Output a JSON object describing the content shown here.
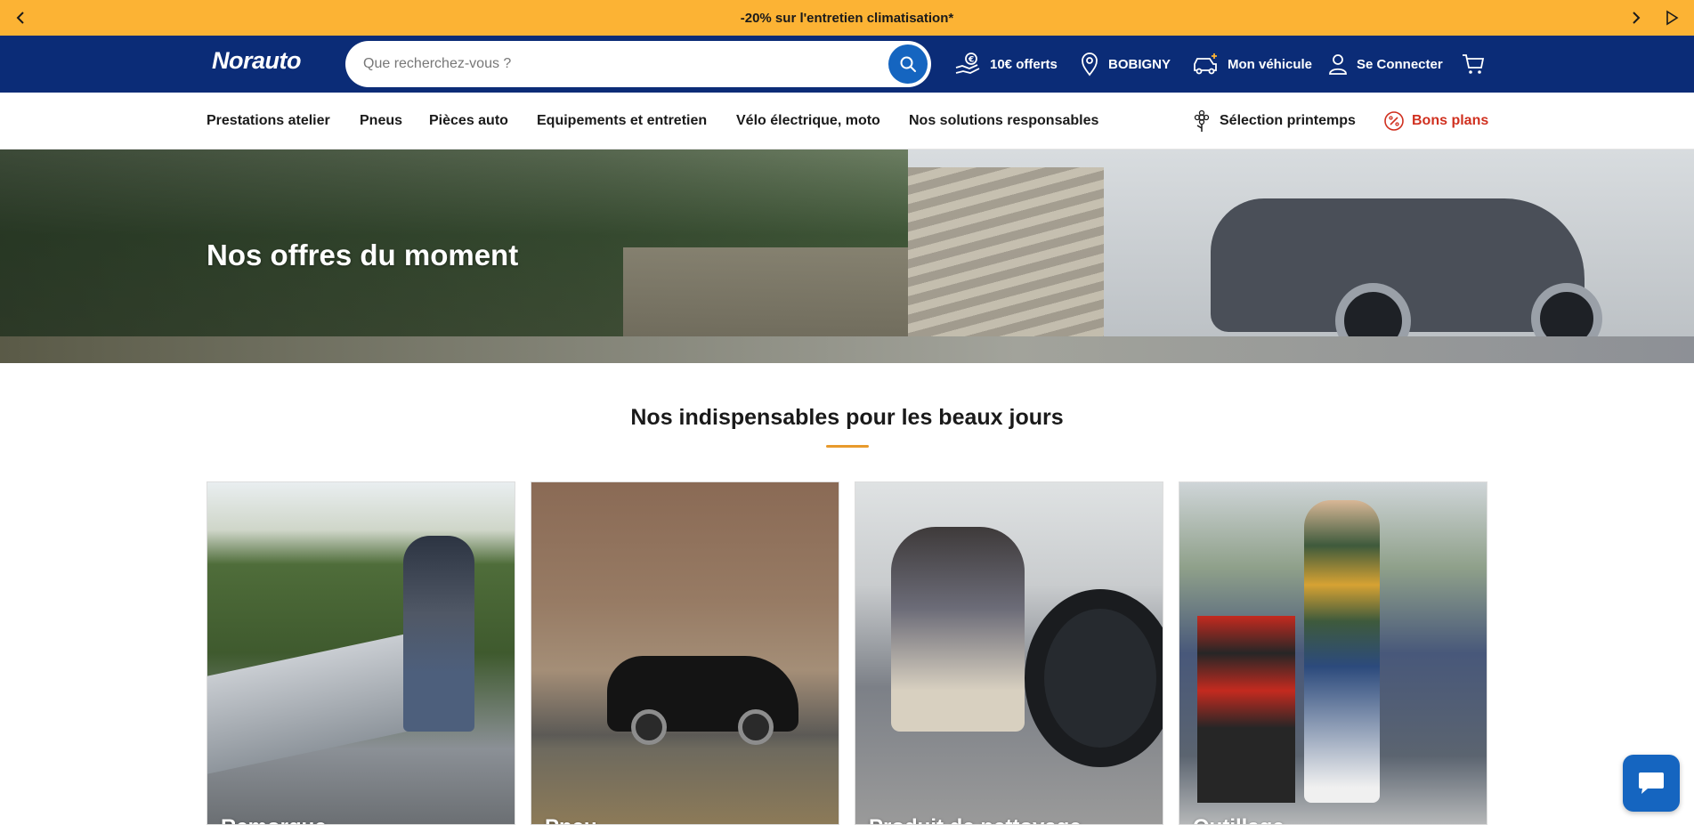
{
  "promo": {
    "text": "-20% sur l'entretien climatisation*"
  },
  "header": {
    "logo": {
      "main": "Norauto"
    },
    "search": {
      "placeholder": "Que recherchez-vous ?"
    },
    "offer_label": "10€ offerts",
    "store_label": "BOBIGNY",
    "vehicle_label": "Mon véhicule",
    "login_label": "Se Connecter"
  },
  "nav": {
    "items": [
      {
        "label": "Prestations atelier"
      },
      {
        "label": "Pneus"
      },
      {
        "label": "Pièces auto"
      },
      {
        "label": "Equipements et entretien"
      },
      {
        "label": "Vélo électrique, moto"
      },
      {
        "label": "Nos solutions responsables"
      }
    ],
    "spring_label": "Sélection printemps",
    "deals_label": "Bons plans"
  },
  "hero": {
    "title": "Nos offres du moment"
  },
  "section": {
    "title": "Nos indispensables pour les beaux jours",
    "cards": [
      {
        "label": "Remorque"
      },
      {
        "label": "Pneu"
      },
      {
        "label": "Produit de nettoyage"
      },
      {
        "label": "Outillage"
      }
    ]
  },
  "colors": {
    "promo_bg": "#fcb334",
    "header_bg": "#0b2c77",
    "search_btn": "#1565c0",
    "deals": "#d0301f",
    "accent_underline": "#e89a2c",
    "chat_btn": "#1565c0"
  },
  "icons": {
    "promo_prev": "chevron-left-icon",
    "promo_next": "chevron-right-icon",
    "promo_play": "play-icon",
    "search": "search-icon",
    "offer": "hand-coin-icon",
    "store": "map-pin-icon",
    "vehicle": "car-plus-icon",
    "login": "user-icon",
    "cart": "cart-icon",
    "spring": "flower-icon",
    "deals": "percent-badge-icon",
    "chat": "chat-bubble-icon"
  }
}
